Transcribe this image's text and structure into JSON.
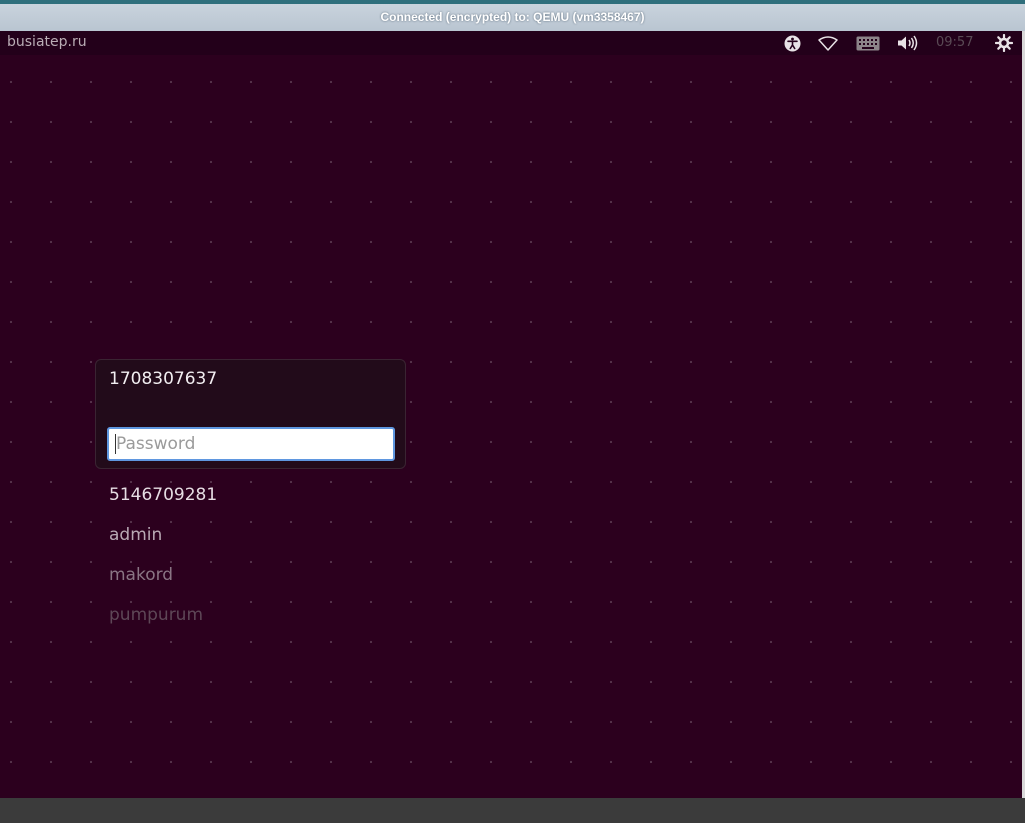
{
  "viewer": {
    "title": "Connected (encrypted) to: QEMU (vm3358467)"
  },
  "panel": {
    "hostname": "busiatep.ru",
    "clock": "09:57",
    "icons": [
      "accessibility-icon",
      "wifi-icon",
      "keyboard-icon",
      "volume-icon",
      "power-gear-icon"
    ]
  },
  "login": {
    "selected_user": "1708307637",
    "password_placeholder": "Password",
    "other_users": [
      {
        "name": "5146709281",
        "color": "#e6dde3"
      },
      {
        "name": "admin",
        "color": "#b9a9b4"
      },
      {
        "name": "makord",
        "color": "#8a7584"
      },
      {
        "name": "pumpurum",
        "color": "#5e4757"
      }
    ]
  },
  "colors": {
    "background": "#2c001e",
    "panel": "#23001a",
    "focus": "#5f97e0"
  }
}
